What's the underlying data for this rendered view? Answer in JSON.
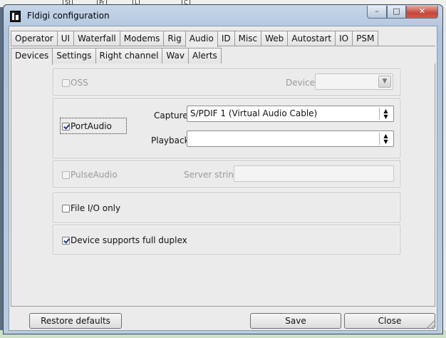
{
  "background": {
    "tabs": [
      "St",
      "Pr",
      "L",
      "C"
    ]
  },
  "window": {
    "title": "Fldigi configuration",
    "controls": {
      "minimize": "–",
      "maximize": "□",
      "close": "✕"
    }
  },
  "tabs_main": [
    {
      "label": "Operator",
      "active": false
    },
    {
      "label": "UI",
      "active": false
    },
    {
      "label": "Waterfall",
      "active": false
    },
    {
      "label": "Modems",
      "active": false
    },
    {
      "label": "Rig",
      "active": false
    },
    {
      "label": "Audio",
      "active": true
    },
    {
      "label": "ID",
      "active": false
    },
    {
      "label": "Misc",
      "active": false
    },
    {
      "label": "Web",
      "active": false
    },
    {
      "label": "Autostart",
      "active": false
    },
    {
      "label": "IO",
      "active": false
    },
    {
      "label": "PSM",
      "active": false
    }
  ],
  "tabs_sub": [
    {
      "label": "Devices",
      "active": true
    },
    {
      "label": "Settings",
      "active": false
    },
    {
      "label": "Right channel",
      "active": false
    },
    {
      "label": "Wav",
      "active": false
    },
    {
      "label": "Alerts",
      "active": false
    }
  ],
  "devices": {
    "oss": {
      "label": "OSS",
      "checked": false,
      "enabled": false,
      "device_label": "Device:",
      "device_value": ""
    },
    "portaudio": {
      "label": "PortAudio",
      "checked": true,
      "capture_label": "Capture:",
      "capture_value": "S/PDIF 1 (Virtual Audio Cable)",
      "playback_label": "Playback:",
      "playback_value": ""
    },
    "pulseaudio": {
      "label": "PulseAudio",
      "checked": false,
      "enabled": false,
      "server_label": "Server string:",
      "server_value": ""
    },
    "file_io": {
      "label": "File I/O only",
      "checked": false
    },
    "full_duplex": {
      "label": "Device supports full duplex",
      "checked": true
    }
  },
  "buttons": {
    "restore": "Restore defaults",
    "save": "Save",
    "close": "Close"
  },
  "icons": {
    "app": "fldigi-app-icon",
    "spinner": "updown-arrows-icon",
    "dropdown": "chevron-down-icon"
  }
}
